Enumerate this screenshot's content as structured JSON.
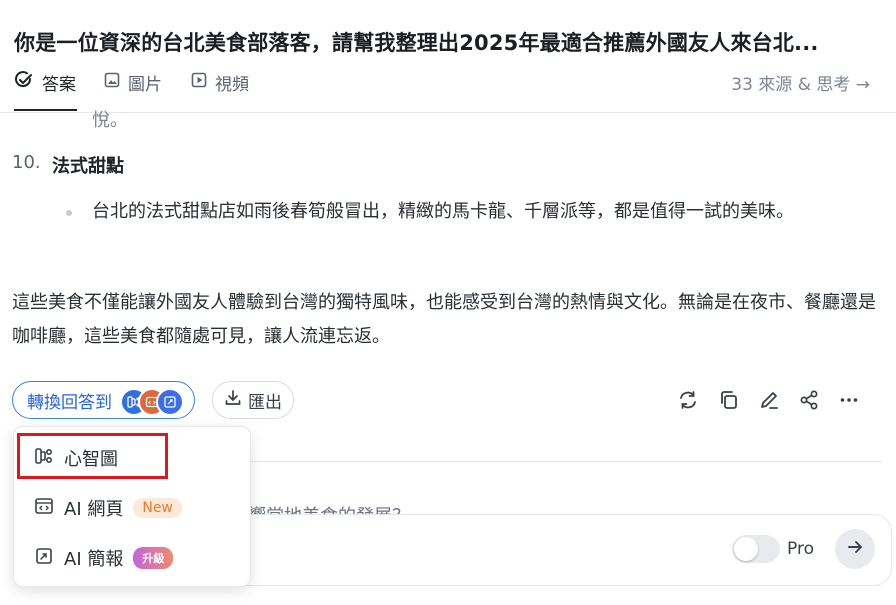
{
  "header": {
    "title": "你是一位資深的台北美食部落客，請幫我整理出2025年最適合推薦外國友人來台北..."
  },
  "tabs": [
    {
      "label": "答案"
    },
    {
      "label": "圖片"
    },
    {
      "label": "視頻"
    }
  ],
  "sources_link": "33 來源 & 思考 →",
  "content": {
    "cut_line": "悅。",
    "item_number": "10.",
    "item_heading": "法式甜點",
    "bullet": "台北的法式甜點店如雨後春筍般冒出，精緻的馬卡龍、千層派等，都是值得一試的美味。",
    "paragraph": "這些美食不僅能讓外國友人體驗到台灣的獨特風味，也能感受到台灣的熱情與文化。無論是在夜市、餐廳還是咖啡廳，這些美食都隨處可見，讓人流連忘返。"
  },
  "toolbar": {
    "convert_label": "轉換回答到",
    "export_label": "匯出"
  },
  "dropdown": {
    "items": [
      {
        "label": "心智圖",
        "icon": "mindmap-icon"
      },
      {
        "label": "AI 網頁",
        "icon": "webpage-icon",
        "badge": "New"
      },
      {
        "label": "AI 簡報",
        "icon": "slides-icon",
        "badge": "升級"
      }
    ]
  },
  "followup_partial": "響當地美食的發展？",
  "composer": {
    "pro_label": "Pro",
    "pro_enabled": false
  },
  "colors": {
    "accent": "#2563eb",
    "highlight_box": "#e0161b",
    "new_badge": "#e87b2a"
  }
}
